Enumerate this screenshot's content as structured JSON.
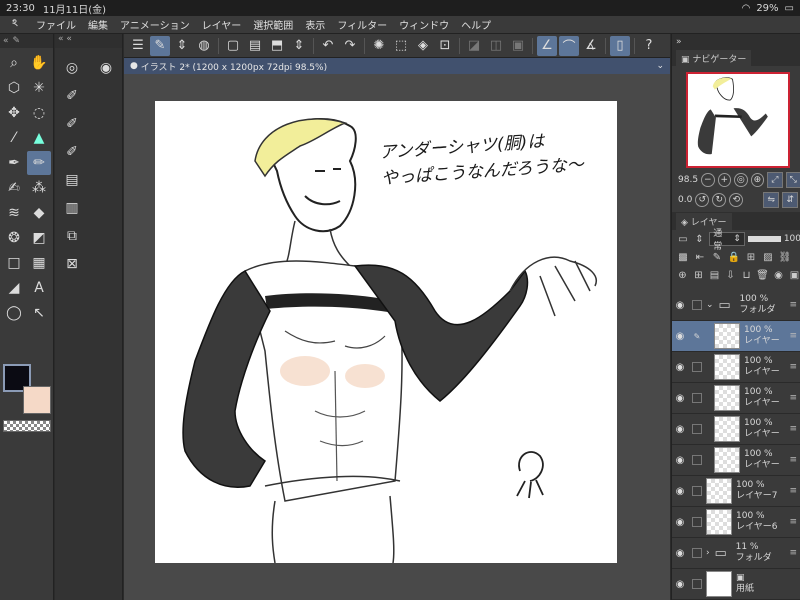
{
  "status": {
    "time": "23:30",
    "date": "11月11日(金)",
    "wifi_icon": "wifi-icon",
    "battery": "29%"
  },
  "menu": [
    "ファイル",
    "編集",
    "アニメーション",
    "レイヤー",
    "選択範囲",
    "表示",
    "フィルター",
    "ウィンドウ",
    "ヘルプ"
  ],
  "document": {
    "tab": "イラスト 2* (1200 x 1200px 72dpi 98.5%)"
  },
  "canvas": {
    "note_line1": "アンダーシャツ(胴)は",
    "note_line2": "やっぱこうなんだろうな〜"
  },
  "panels": {
    "navigator": "ナビゲーター",
    "layer": "レイヤー",
    "zoom": "98.5",
    "rotation": "0.0",
    "blend_mode": "通常",
    "opacity": "100"
  },
  "layers": [
    {
      "opacity": "100 %",
      "name": "フォルダ",
      "type": "folder",
      "expanded": true
    },
    {
      "opacity": "100 %",
      "name": "レイヤー",
      "type": "layer",
      "selected": true,
      "indent": true
    },
    {
      "opacity": "100 %",
      "name": "レイヤー",
      "type": "layer",
      "indent": true
    },
    {
      "opacity": "100 %",
      "name": "レイヤー",
      "type": "layer",
      "indent": true
    },
    {
      "opacity": "100 %",
      "name": "レイヤー",
      "type": "layer",
      "indent": true
    },
    {
      "opacity": "100 %",
      "name": "レイヤー",
      "type": "layer",
      "indent": true
    },
    {
      "opacity": "100 %",
      "name": "レイヤー7",
      "type": "layer"
    },
    {
      "opacity": "100 %",
      "name": "レイヤー6",
      "type": "layer"
    },
    {
      "opacity": "11 %",
      "name": "フォルダ",
      "type": "folder",
      "expanded": false
    },
    {
      "opacity": "",
      "name": "用紙",
      "type": "paper"
    }
  ],
  "colors": {
    "main": "#0b0b13",
    "sub": "#f5d9c7",
    "accent": "#5d7699"
  }
}
